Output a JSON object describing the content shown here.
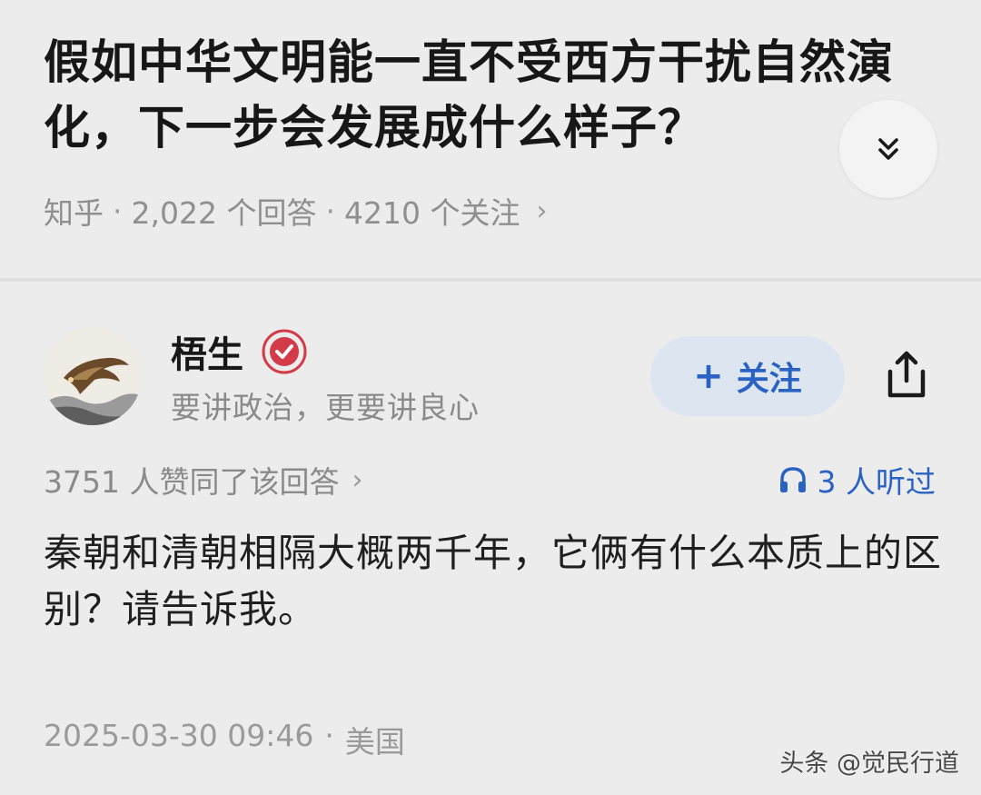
{
  "question": {
    "title": "假如中华文明能一直不受西方干扰自然演化，下一步会发展成什么样子？",
    "source": "知乎",
    "answers_count": "2,022 个回答",
    "followers_count": "4210 个关注",
    "separator": "·",
    "meta_chevron": "›"
  },
  "author": {
    "name": "梧生",
    "bio": "要讲政治，更要讲良心",
    "follow_label": "关注",
    "follow_plus": "+"
  },
  "answer": {
    "upvotes_label": "3751 人赞同了该回答",
    "upvotes_chevron": "›",
    "listeners_label": "3 人听过",
    "content": "秦朝和清朝相隔大概两千年，它俩有什么本质上的区别？请告诉我。",
    "datetime": "2025-03-30 09:46",
    "separator": "·",
    "location": "美国"
  },
  "watermark": {
    "text": "头条 @觉民行道"
  },
  "icons": {
    "collapse": "chevron-double-down-icon",
    "badge": "verified-badge-icon",
    "share": "share-icon",
    "headphones": "headphones-icon"
  },
  "colors": {
    "accent_blue": "#2a62c4",
    "follow_bg": "#dde5f0",
    "background": "#ececec",
    "badge_red": "#d23b47"
  }
}
